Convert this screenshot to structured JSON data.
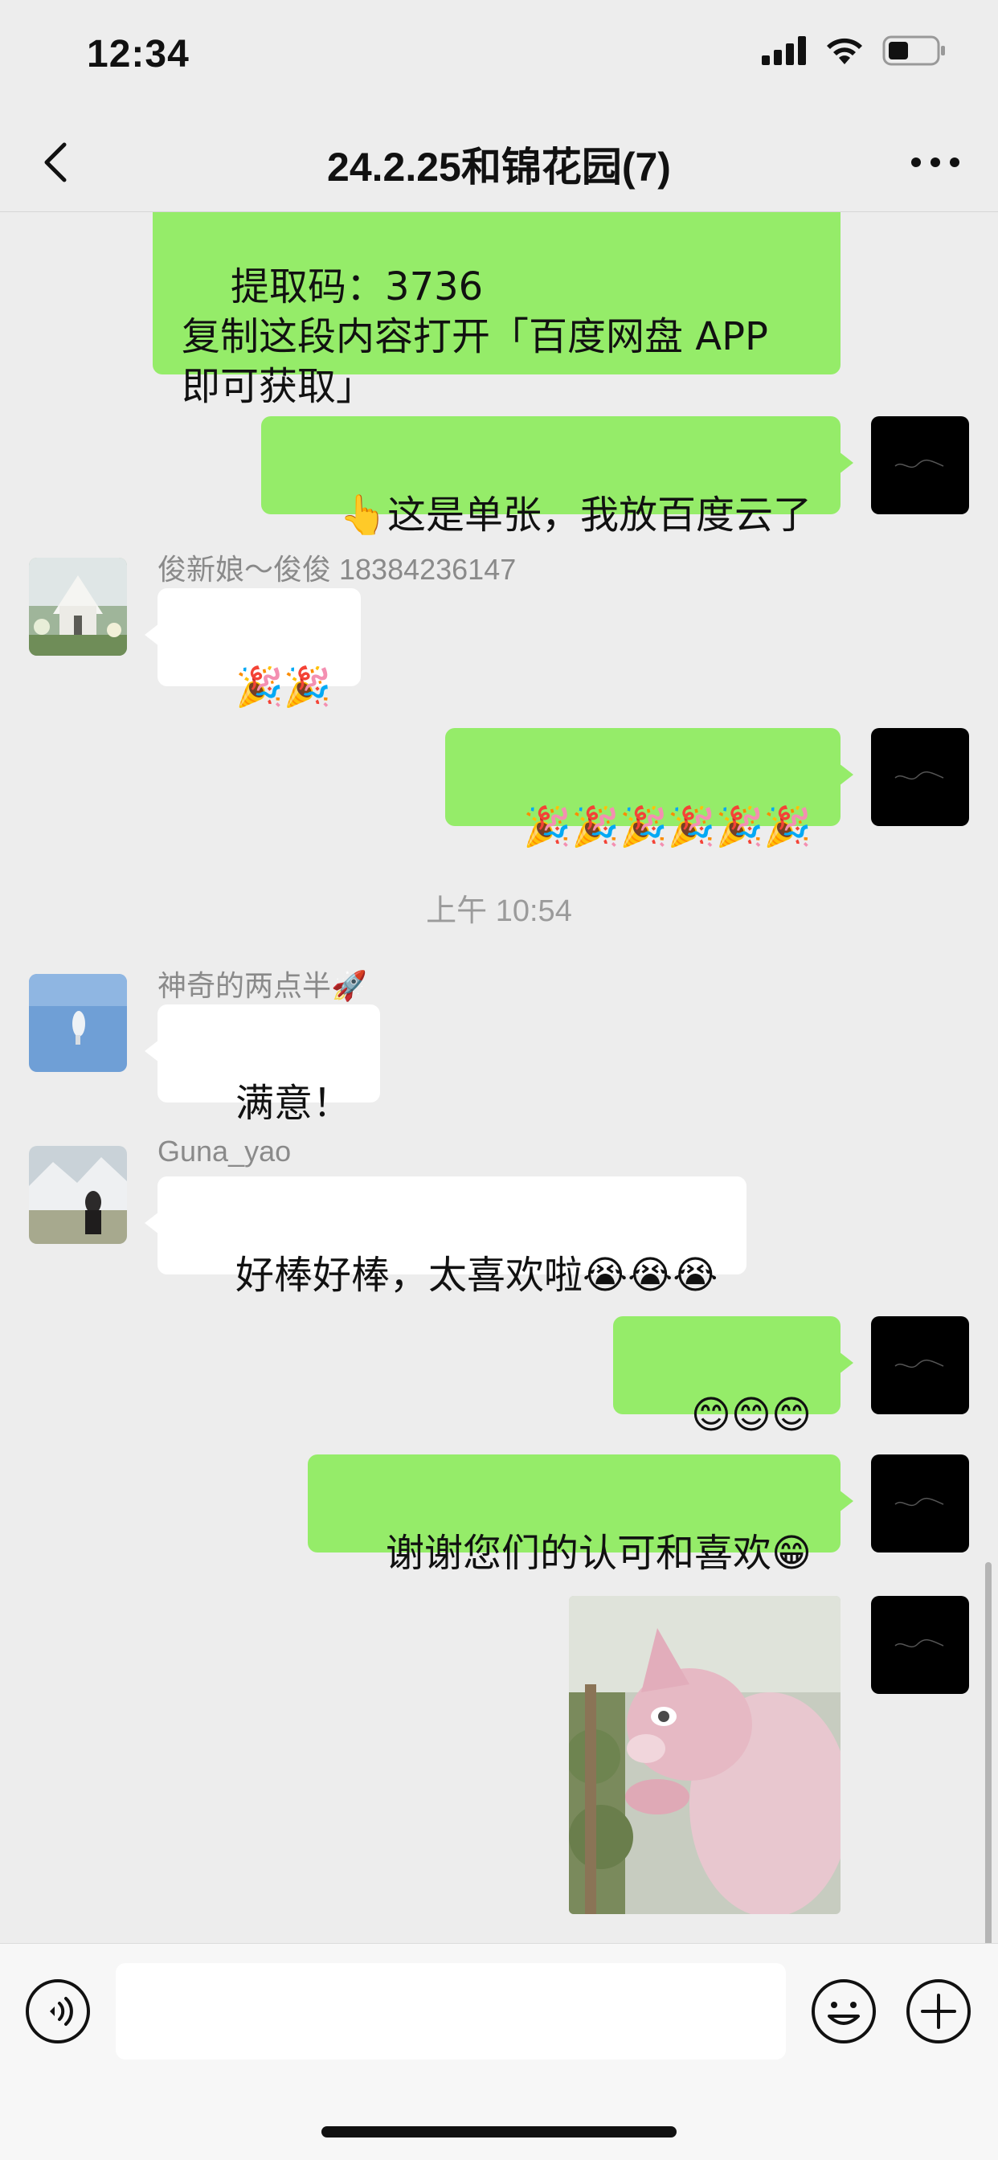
{
  "status_bar": {
    "time": "12:34"
  },
  "header": {
    "title": "24.2.25和锦花园(7)"
  },
  "messages": {
    "m1_text": "提取码：3736\n复制这段内容打开「百度网盘 APP\n即可获取」",
    "m2_text": "👆这是单张，我放百度云了",
    "m3_sender": "俊新娘～俊俊 18384236147",
    "m3_text": "🎉🎉",
    "m4_text": "🎉🎉🎉🎉🎉🎉",
    "time_sep": "上午 10:54",
    "m5_sender": "神奇的两点半🚀",
    "m5_text": "满意！",
    "m6_sender": "Guna_yao",
    "m6_text": "好棒好棒，太喜欢啦😭😭😭",
    "m7_text": "😊😊😊",
    "m8_text": "谢谢您们的认可和喜欢😁"
  },
  "input": {
    "value": ""
  },
  "icons": {
    "back": "chevron-left-icon",
    "more": "more-dots-icon",
    "voice": "voice-icon",
    "emoji": "smiley-icon",
    "plus": "plus-icon"
  },
  "colors": {
    "self_bubble": "#95ec69",
    "other_bubble": "#ffffff",
    "background": "#ededed"
  }
}
